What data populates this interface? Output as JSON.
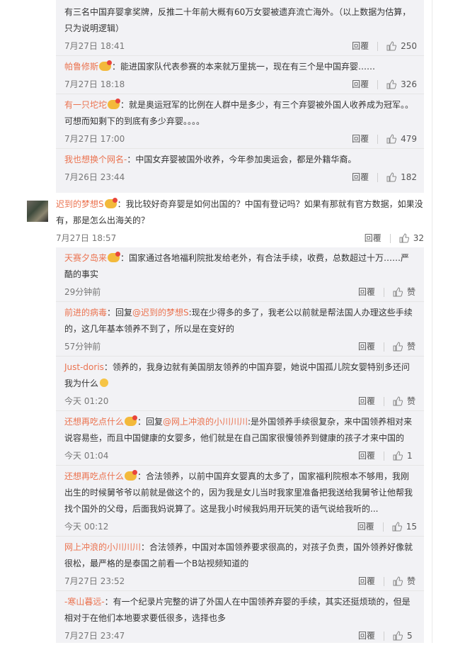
{
  "comments_top": [
    {
      "user": "",
      "text": "有三名中国弃婴拿奖牌，反推二十年前大概有60万女婴被遗弃流亡海外。（以上数据为估算，只为说明逻辑）",
      "time": "7月27日 18:41",
      "likes": "250"
    },
    {
      "user": "帕鲁修斯",
      "text": "：能进国家队代表参赛的本来就万里挑一，现在有三个是中国弃婴……",
      "time": "7月27日 18:18",
      "likes": "326"
    },
    {
      "user": "有一只坨坨",
      "text": "：就是奥运冠军的比例在人群中是多少，有三个弃婴被外国人收养成为冠军。。可想而知剩下的到底有多少弃婴。。。。",
      "time": "7月27日 17:00",
      "likes": "479"
    },
    {
      "user": "我也想换个网名-",
      "text": "：中国女弃婴被国外收养，今年参加奥运会，都是外籍华裔。",
      "time": "7月26日 23:44",
      "likes": "182"
    }
  ],
  "main_comment": {
    "user": "迟到的梦想S",
    "text": "：我比较好奇弃婴是如何出国的？中国有登记吗？如果有那就有官方数据，如果没有，那是怎么出海关的？",
    "time": "7月27日 18:57",
    "likes": "32"
  },
  "replies": [
    {
      "user": "天赛夕岛来",
      "badge": true,
      "text": "：国家通过各地福利院批发给老外，有合法手续，收费，总数超过十万……严酷的事实",
      "time": "29分钟前",
      "likes": "赞"
    },
    {
      "user": "前进的病毒",
      "badge": false,
      "prefix": "：回复",
      "at": "@迟到的梦想S",
      "text": ":现在少得多的多了，我老公以前就是帮法国人办理这些手续的，这几年基本领养不到了，所以是在变好的",
      "time": "57分钟前",
      "likes": "赞"
    },
    {
      "user": "Just-doris",
      "badge": false,
      "text": "：领养的，我身边就有美国朋友领养的中国弃婴，她说中国孤儿院女婴特别多还问我为什么",
      "time": "今天 01:20",
      "likes": "赞"
    },
    {
      "user": "还想再吃点什么",
      "badge": true,
      "prefix": "：回复",
      "at": "@网上冲浪的小川川川",
      "text": ":是外国领养手续很复杂，来中国领养相对来说容易些，而且中国健康的女婴多，他们就是在自己国家很慢领养到健康的孩子才来中国的",
      "time": "今天 01:04",
      "likes": "1"
    },
    {
      "user": "还想再吃点什么",
      "badge": true,
      "text": "：合法领养，以前中国弃女婴真的太多了，国家福利院根本不够用，我刚出生的时候舅爷爷以前就是做这个的，因为我是女儿当时我家里准备把我送给我舅爷让他帮我找个国外的父母，后面我妈说算了。这是我小时候我妈用开玩笑的语气说给我听的...",
      "time": "今天 00:12",
      "likes": "15"
    },
    {
      "user": "网上冲浪的小川川川",
      "badge": false,
      "text": "：合法领养，中国对本国领养要求很高的，对孩子负责，国外领养好像就很松，最严格的是泰国之前看一个B站视频知道的",
      "time": "7月27日 23:52",
      "likes": "赞"
    },
    {
      "user": "-寒山暮远-",
      "badge": false,
      "text": "：有一个纪录片完整的讲了外国人在中国领养弃婴的手续，其实还挺烦琐的，但是相对于在他们本地要求要低很多，选择也多",
      "time": "7月27日 23:47",
      "likes": "5"
    }
  ],
  "ui": {
    "reply_label": "回覆"
  },
  "colors": {
    "username": "#eb7350",
    "reply_bg": "#f2f2f5",
    "meta": "#777777"
  },
  "icons": {
    "like": "thumbs-up-icon",
    "badge": "member-badge-icon",
    "emoji": "smile-emoji-icon"
  }
}
